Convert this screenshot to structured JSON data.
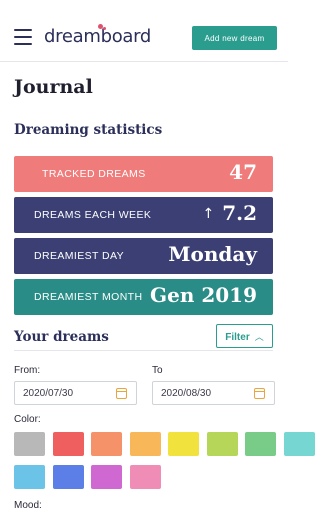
{
  "header": {
    "logo_text": "dreamboard",
    "add_button_label": "Add new dream"
  },
  "page_title": "Journal",
  "stats": {
    "title": "Dreaming statistics",
    "cards": [
      {
        "label": "TRACKED DREAMS",
        "value": "47",
        "color": "#f07b7b"
      },
      {
        "label": "DREAMS EACH WEEK",
        "value": "7.2",
        "arrow": "↑",
        "color": "#3b3f73"
      },
      {
        "label": "DREAMIEST DAY",
        "value": "Monday",
        "color": "#3b3f73"
      },
      {
        "label": "DREAMIEST MONTH",
        "value": "Gen 2019",
        "color": "#2a8c86"
      }
    ]
  },
  "dreams": {
    "title": "Your dreams",
    "filter_label": "Filter",
    "from_label": "From:",
    "from_value": "2020/07/30",
    "to_label": "To",
    "to_value": "2020/08/30",
    "color_label": "Color:",
    "mood_label": "Mood:",
    "colors": [
      "#b8b8b8",
      "#ef5f5f",
      "#f5926a",
      "#f8b85a",
      "#f2e23e",
      "#b6d65a",
      "#79cc88",
      "#76d6d2",
      "#6cc3e8",
      "#5b7fe6",
      "#cf68d1",
      "#f08db6"
    ]
  }
}
